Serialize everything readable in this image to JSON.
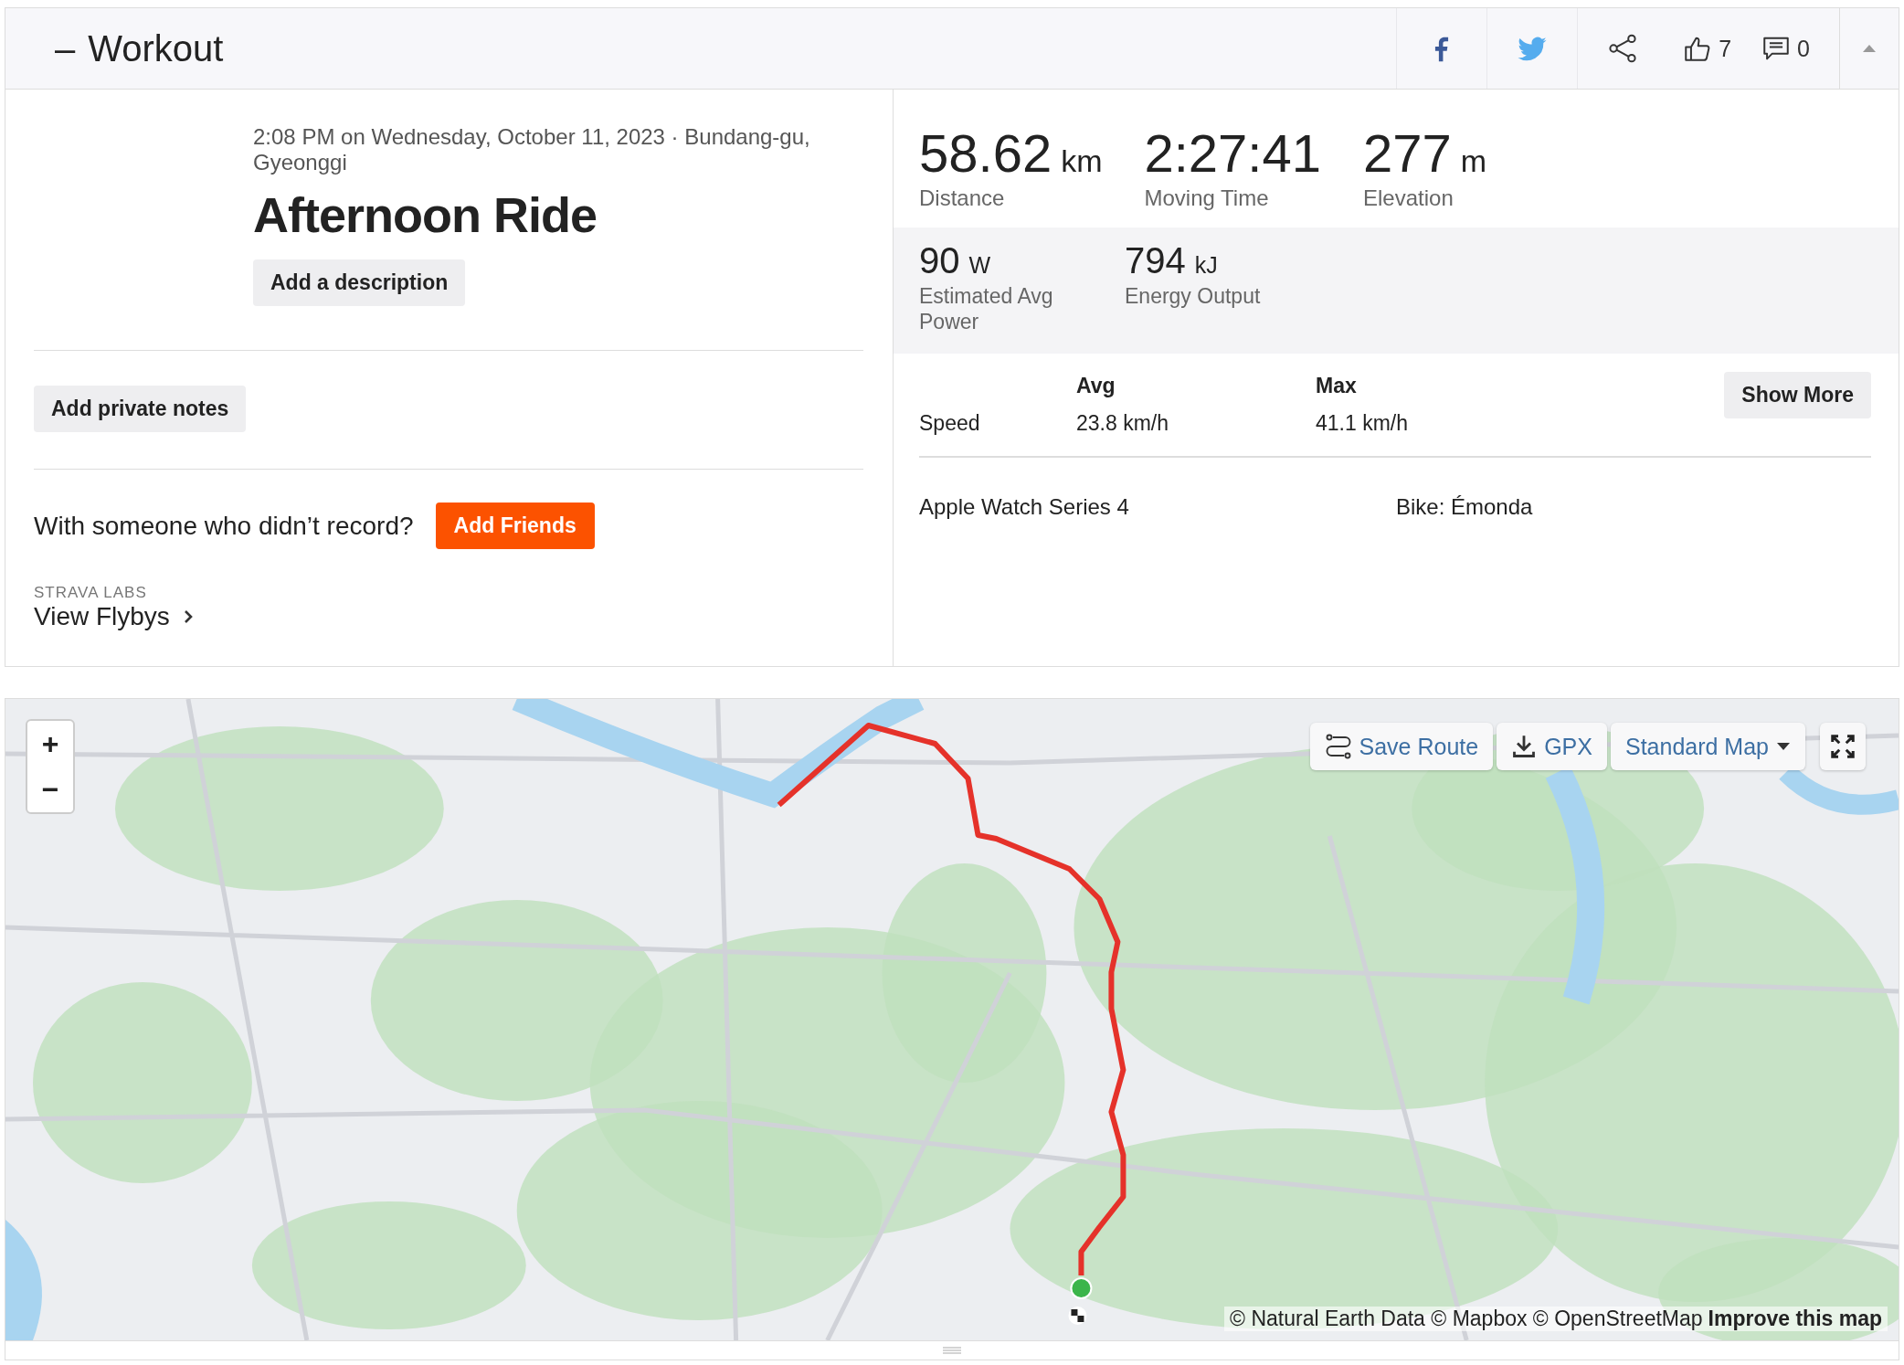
{
  "header": {
    "toggle": "–",
    "title": "Workout",
    "actions": [
      {
        "kind": "facebook"
      },
      {
        "kind": "twitter"
      },
      {
        "kind": "share"
      },
      {
        "kind": "kudos",
        "count": "7"
      },
      {
        "kind": "comments",
        "count": "0"
      }
    ]
  },
  "activity": {
    "meta": "2:08 PM on Wednesday, October 11, 2023 · Bundang-gu, Gyeonggi",
    "title": "Afternoon Ride",
    "description_button": "Add a description",
    "notes_button": "Add private notes",
    "friends_prompt": "With someone who didn’t record?",
    "friends_button": "Add Friends",
    "labs_label": "STRAVA LABS",
    "flybys_link": "View Flybys"
  },
  "stats": {
    "primary": [
      {
        "value": "58.62",
        "unit": "km",
        "label": "Distance"
      },
      {
        "value": "2:27:41",
        "label": "Moving Time"
      },
      {
        "value": "277",
        "unit": "m",
        "label": "Elevation"
      }
    ],
    "secondary": [
      {
        "value": "90",
        "unit": "W",
        "label": "Estimated Avg Power"
      },
      {
        "value": "794",
        "unit": "kJ",
        "label": "Energy Output"
      }
    ],
    "speed": {
      "columns": [
        "Avg",
        "Max"
      ],
      "label": "Speed",
      "values": [
        "23.8 km/h",
        "41.1 km/h"
      ]
    },
    "show_more": "Show More",
    "device": "Apple Watch Series 4",
    "bike": "Bike: Émonda"
  },
  "map": {
    "zoom_in": "+",
    "zoom_out": "−",
    "save_route": "Save Route",
    "gpx": "GPX",
    "style_menu": "Standard Map",
    "attribution": "© Natural Earth Data © Mapbox © OpenStreetMap",
    "improve_link": "Improve this map"
  }
}
